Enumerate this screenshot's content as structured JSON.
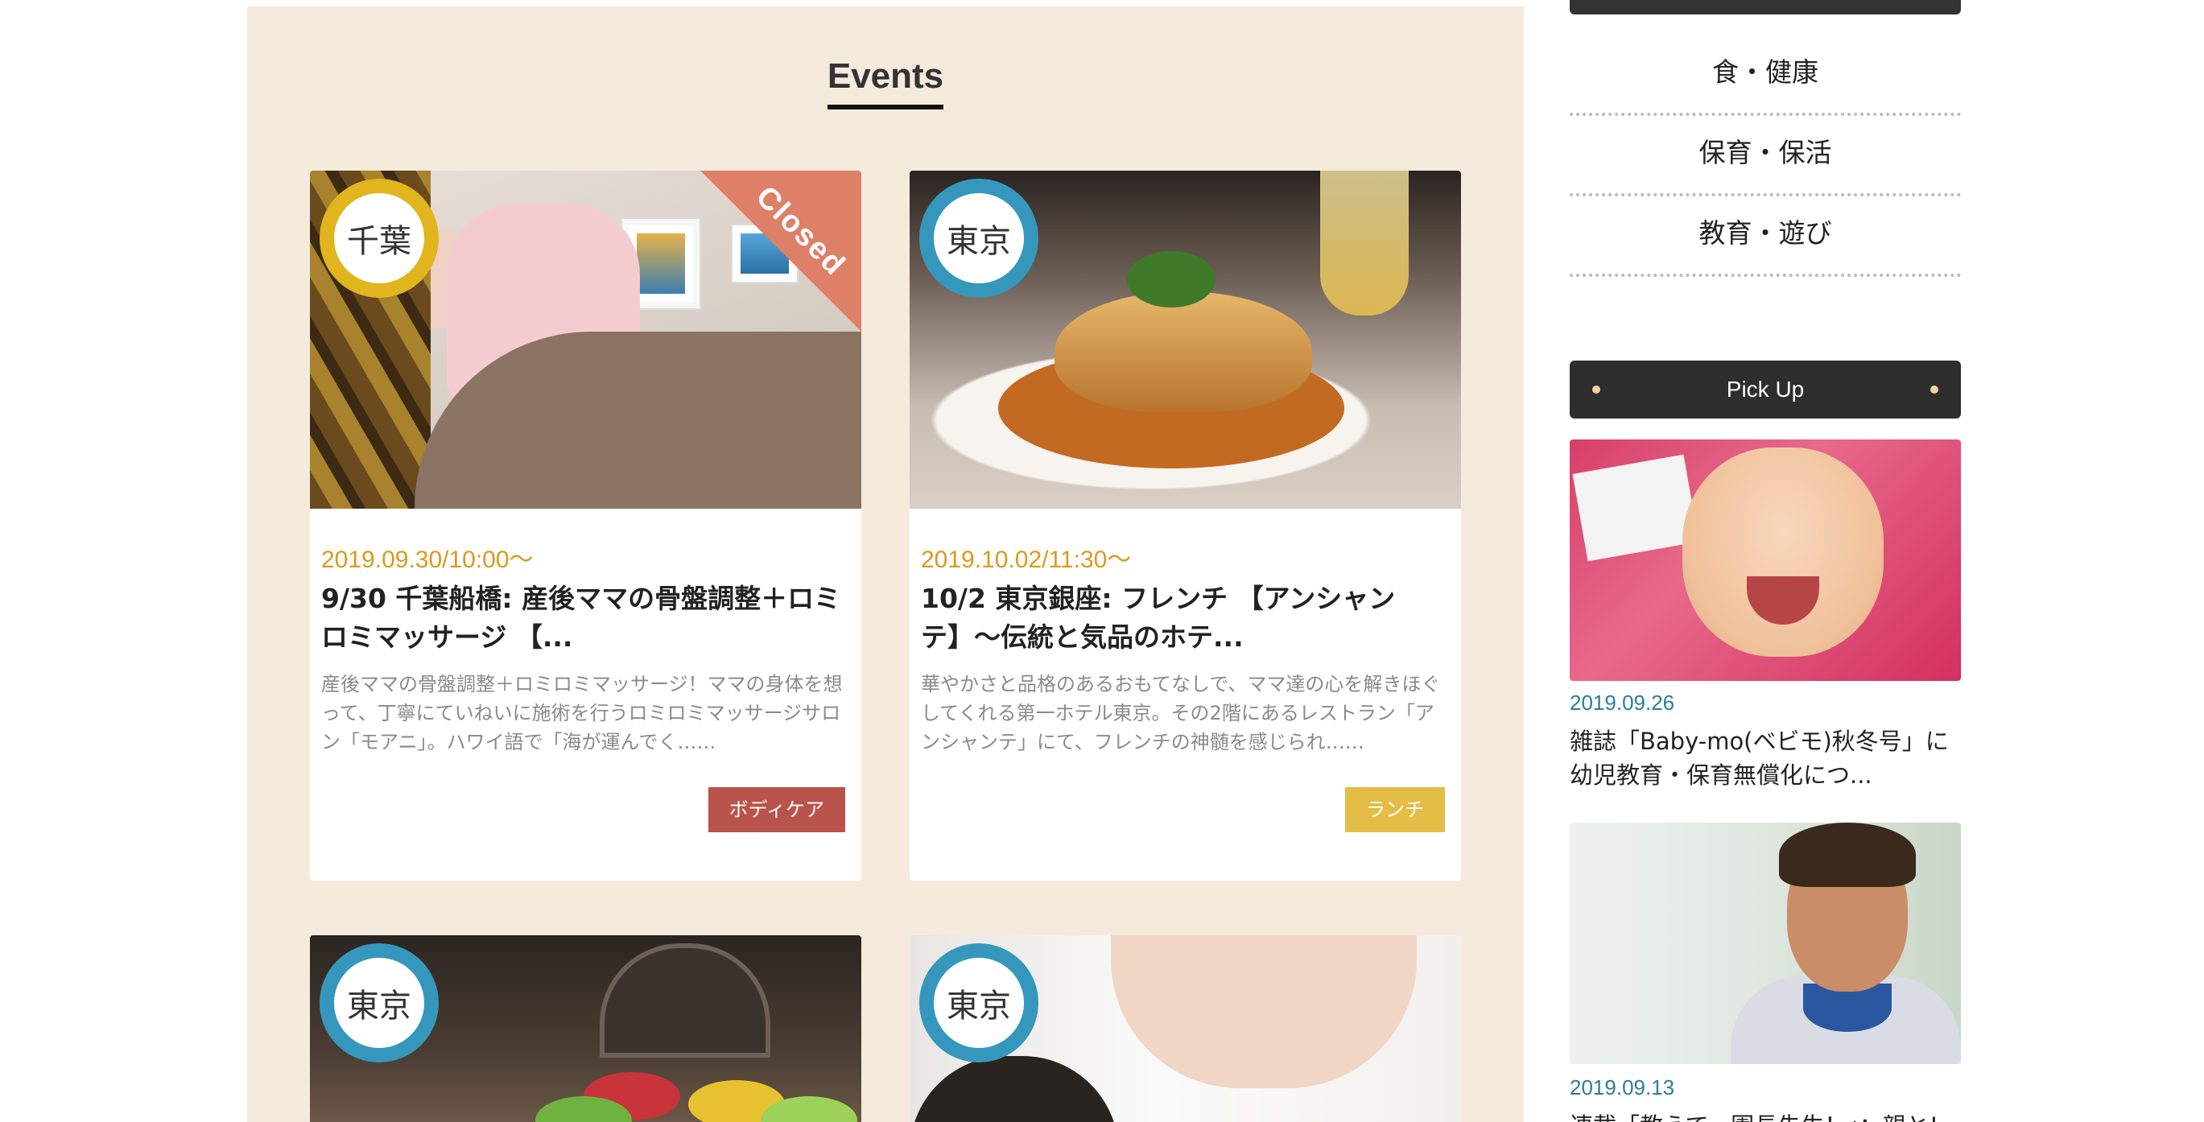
{
  "events": {
    "heading": "Events",
    "cards": [
      {
        "area": "千葉",
        "closed_label": "Closed",
        "date": "2019.09.30/10:00〜",
        "title": "9/30 千葉船橋: 産後ママの骨盤調整＋ロミロミマッサージ 【...",
        "excerpt": "産後ママの骨盤調整＋ロミロミマッサージ！ママの身体を想って、丁寧にていねいに施術を行うロミロミマッサージサロン「モアニ」。ハワイ語で「海が運んでく……",
        "tag": "ボディケア"
      },
      {
        "area": "東京",
        "date": "2019.10.02/11:30〜",
        "title": "10/2 東京銀座: フレンチ 【アンシャンテ】〜伝統と気品のホテ...",
        "excerpt": "華やかさと品格のあるおもてなしで、ママ達の心を解きほぐしてくれる第一ホテル東京。その2階にあるレストラン「アンシャンテ」にて、フレンチの神髄を感じられ……",
        "tag": "ランチ"
      },
      {
        "area": "東京"
      },
      {
        "area": "東京"
      }
    ]
  },
  "sidebar": {
    "categories": [
      "食・健康",
      "保育・保活",
      "教育・遊び"
    ],
    "pickup_heading": "Pick Up",
    "pickups": [
      {
        "date": "2019.09.26",
        "title": "雑誌「Baby-mo(ベビモ)秋冬号」に幼児教育・保育無償化につ..."
      },
      {
        "date": "2019.09.13",
        "title": "連載「教えて、園長先生！」：親と!"
      }
    ]
  },
  "colors": {
    "panel_bg": "#f5ebdd",
    "date_orange": "#d99a1e",
    "tag_red": "#b9534b",
    "tag_yellow": "#e3bd45",
    "badge_yellow": "#e0b51e",
    "badge_blue": "#3697bd",
    "pickup_date_blue": "#2d7ba0"
  }
}
